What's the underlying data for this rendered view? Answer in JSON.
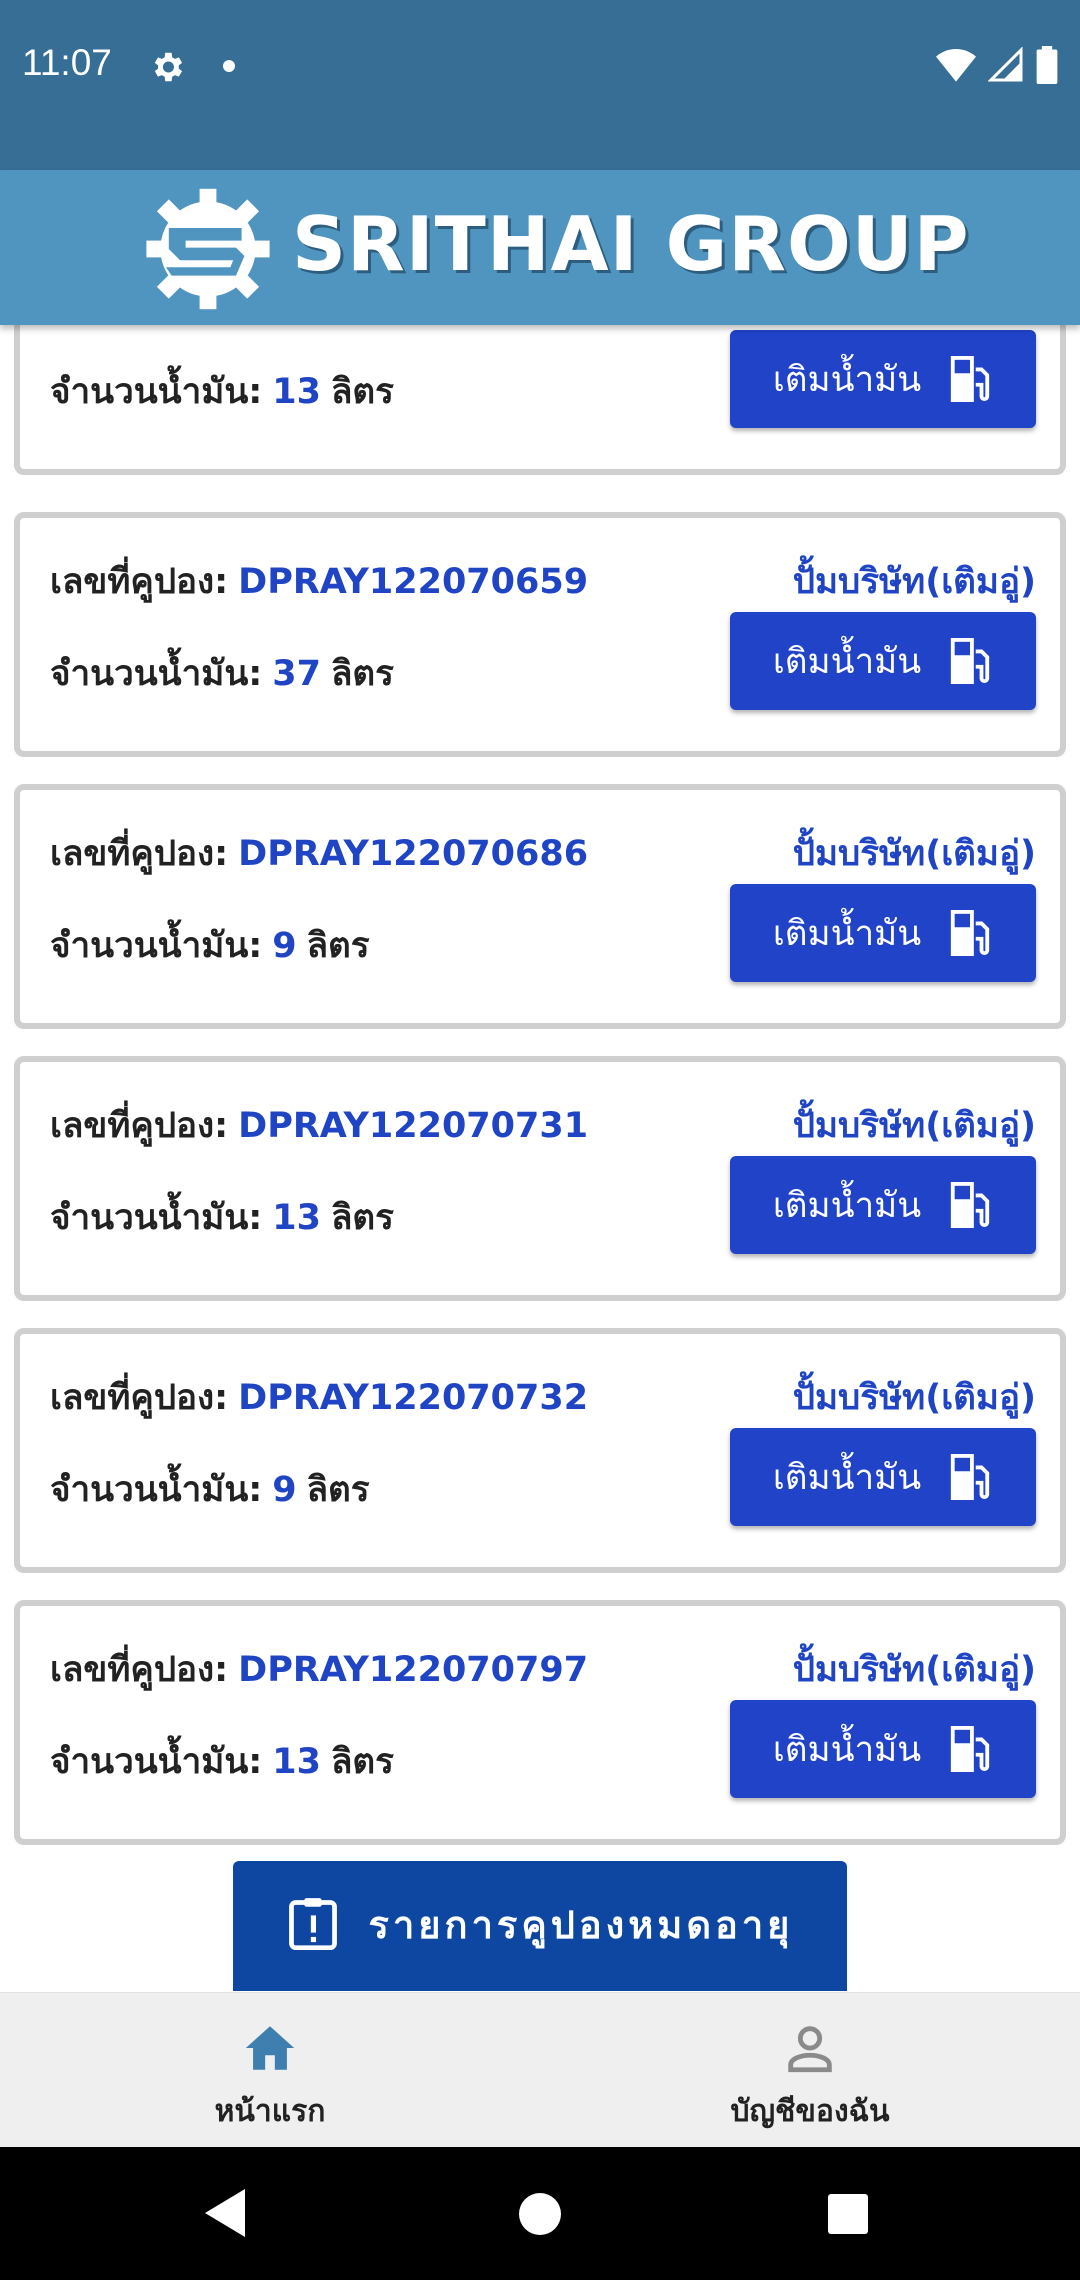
{
  "status_bar": {
    "time": "11:07",
    "icons": [
      "gear-icon",
      "notification-dot-icon",
      "wifi-icon",
      "signal-icon",
      "battery-icon"
    ]
  },
  "header": {
    "brand_name": "SRITHAI GROUP",
    "logo_icon": "srithai-gear-logo",
    "color": "#4f95bf"
  },
  "coupon_label": "เลขที่คูปอง:",
  "fuel_label": "จำนวนน้ำมัน:",
  "unit": "ลิตร",
  "fill_button_label": "เติมน้ำมัน",
  "coupons": [
    {
      "code": "",
      "status": "",
      "liters": "13"
    },
    {
      "code": "DPRAY122070659",
      "status": "ปั้มบริษัท(เติมอู่)",
      "liters": "37"
    },
    {
      "code": "DPRAY122070686",
      "status": "ปั้มบริษัท(เติมอู่)",
      "liters": "9"
    },
    {
      "code": "DPRAY122070731",
      "status": "ปั้มบริษัท(เติมอู่)",
      "liters": "13"
    },
    {
      "code": "DPRAY122070732",
      "status": "ปั้มบริษัท(เติมอู่)",
      "liters": "9"
    },
    {
      "code": "DPRAY122070797",
      "status": "ปั้มบริษัท(เติมอู่)",
      "liters": "13"
    }
  ],
  "expired_button": {
    "label": "รายการคูปองหมดอายุ",
    "icon": "clipboard-alert-icon"
  },
  "bottom_nav": {
    "items": [
      {
        "label": "หน้าแรก",
        "icon": "home-icon",
        "active": true
      },
      {
        "label": "บัญชีของฉัน",
        "icon": "account-icon",
        "active": false
      }
    ]
  },
  "colors": {
    "accent_blue": "#1f44c4",
    "status_bar": "#376e95",
    "expired_button": "#0d47a1"
  }
}
